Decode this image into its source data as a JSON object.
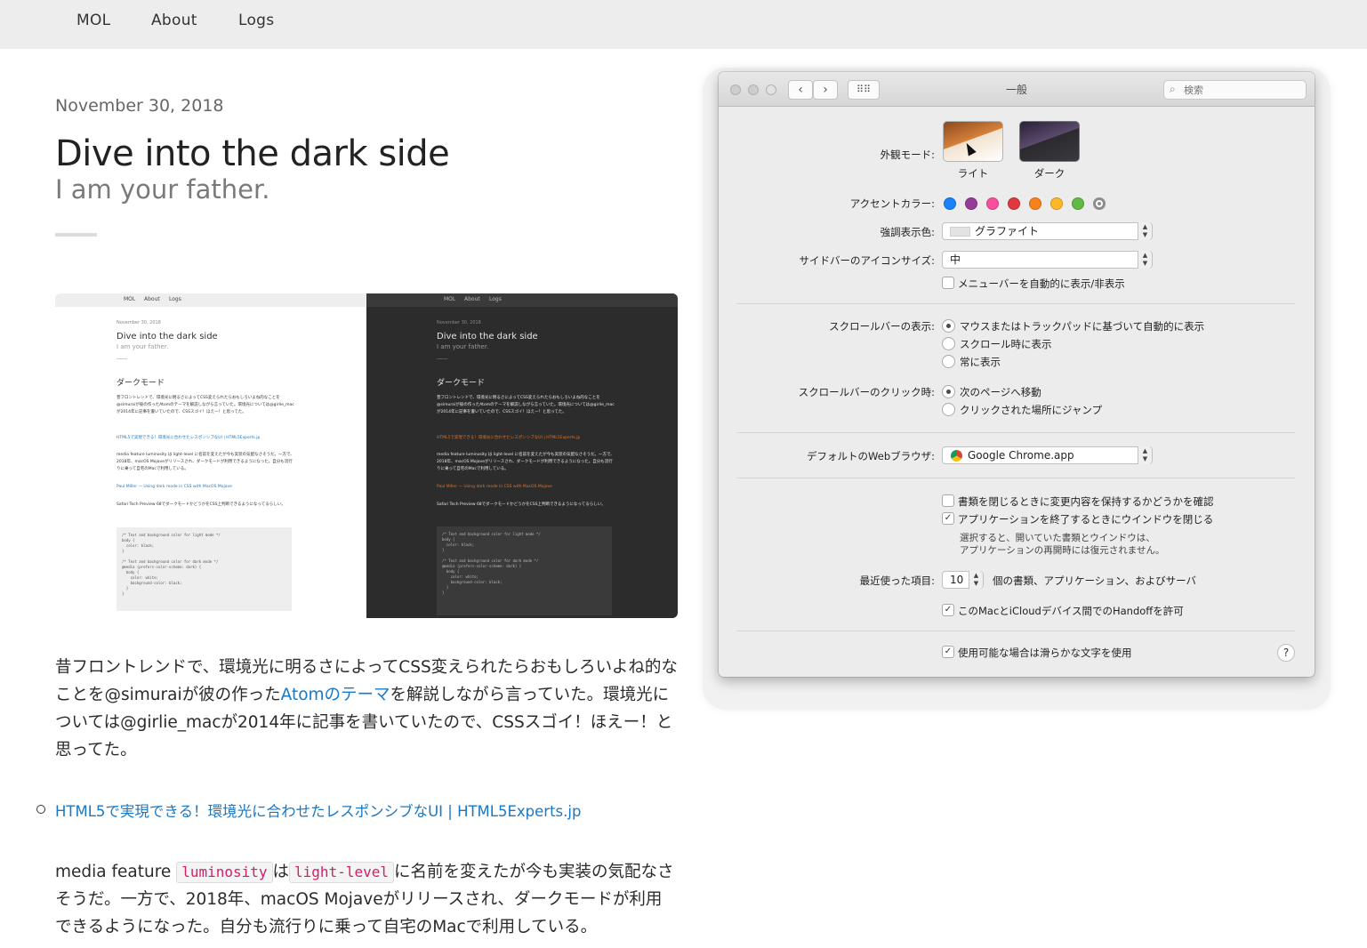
{
  "nav": {
    "items": [
      "MOL",
      "About",
      "Logs"
    ]
  },
  "post": {
    "date": "November 30, 2018",
    "title": "Dive into the dark side",
    "subtitle": "I am your father.",
    "p1_a": "昔フロントレンドで、環境光に明るさによってCSS変えられたらおもしろいよね的なことを@simuraiが彼の作った",
    "p1_link": "Atomのテーマ",
    "p1_b": "を解説しながら言っていた。環境光については@girlie_macが2014年に記事を書いていたので、CSSスゴイ！ほえー！と思ってた。",
    "link1": "HTML5で実現できる！環境光に合わせたレスポンシブなUI | HTML5Experts.jp",
    "p2_a": "media feature ",
    "p2_code1": "luminosity",
    "p2_b": "は",
    "p2_code2": "light-level",
    "p2_c": "に名前を変えたが今も実装の気配なさそうだ。一方で、2018年、macOS Mojaveがリリースされ、ダークモードが利用できるようになった。自分も流行りに乗って自宅のMacで利用している。"
  },
  "thumb": {
    "nav": [
      "MOL",
      "About",
      "Logs"
    ],
    "date": "November 30, 2018",
    "title": "Dive into the dark side",
    "subtitle": "I am your father.",
    "heading": "ダークモード",
    "body1": "昔フロントレンドで、環境光に明るさによってCSS変えられたらおもしろいよね的なことを@simuraiが彼の作ったAtomのテーマを解説しながら言っていた。環境光については@girlie_macが2014年に記事を書いていたので、CSSスゴイ！ほえー！と思ってた。",
    "link1": "HTML5で実現できる！環境光に合わせたレスポンシブなUI | HTML5Experts.jp",
    "body2": "media feature luminosity は light-level に名前を変えたが今も実装の気配なさそうだ。一方で、2018年、macOS Mojaveがリリースされ、ダークモードが利用できるようになった。自分も流行りに乗って自宅のMacで利用している。",
    "link2": "Paul Miller — Using dark mode in CSS with MacOS Mojave",
    "body3": "Safari Tech Preview 68でダークモードかどうかをCSS上判断できるようになってるらしい。",
    "code": "/* Text and background color for light mode */\nbody {\n  color: black;\n}\n\n/* Text and background color for dark mode */\n@media (prefers-color-scheme: dark) {\n  body {\n    color: white;\n    background-color: black;\n  }\n}"
  },
  "prefs": {
    "window_title": "一般",
    "search_placeholder": "検索",
    "appearance_label": "外観モード:",
    "appearance_light": "ライト",
    "appearance_dark": "ダーク",
    "accent_label": "アクセントカラー:",
    "accent_colors": [
      "#1a82fb",
      "#953d96",
      "#f74f9e",
      "#e0383e",
      "#f7821b",
      "#fcb827",
      "#62ba46",
      "#8c8c8c"
    ],
    "highlight_label": "強調表示色:",
    "highlight_value": "グラファイト",
    "sidebar_label": "サイドバーのアイコンサイズ:",
    "sidebar_value": "中",
    "menubar_auto": "メニューバーを自動的に表示/非表示",
    "scroll_show_label": "スクロールバーの表示:",
    "scroll_show_opts": [
      "マウスまたはトラックパッドに基づいて自動的に表示",
      "スクロール時に表示",
      "常に表示"
    ],
    "scroll_click_label": "スクロールバーのクリック時:",
    "scroll_click_opts": [
      "次のページへ移動",
      "クリックされた場所にジャンプ"
    ],
    "browser_label": "デフォルトのWebブラウザ:",
    "browser_value": "Google Chrome.app",
    "ask_keep_changes": "書類を閉じるときに変更内容を保持するかどうかを確認",
    "close_windows": "アプリケーションを終了するときにウインドウを閉じる",
    "close_windows_note_1": "選択すると、開いていた書類とウインドウは、",
    "close_windows_note_2": "アプリケーションの再開時には復元されません。",
    "recent_label": "最近使った項目:",
    "recent_value": "10",
    "recent_suffix": "個の書類、アプリケーション、およびサーバ",
    "handoff": "このMacとiCloudデバイス間でのHandoffを許可",
    "smooth_fonts": "使用可能な場合は滑らかな文字を使用",
    "help": "?"
  }
}
